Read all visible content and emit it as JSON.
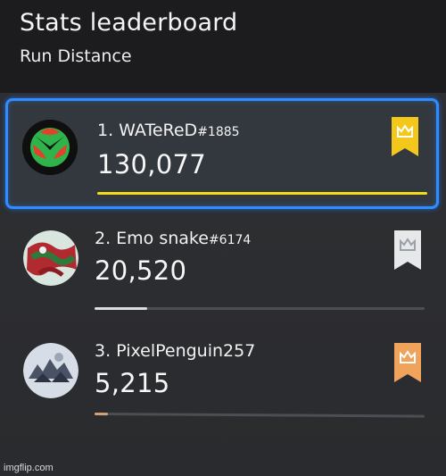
{
  "header": {
    "title": "Stats leaderboard",
    "subtitle": "Run Distance"
  },
  "entries": [
    {
      "rank_name": "1. WATeReD",
      "tag": "#1885",
      "score": "130,077",
      "progress": 1.0,
      "bar_color": "#f4dd17",
      "ribbon_color": "#f3c81a",
      "ribbon_icon": "crown-icon",
      "avatar_icon": "xbox-logo-icon"
    },
    {
      "rank_name": "2. Emo snake",
      "tag": "#6174",
      "score": "20,520",
      "progress": 0.16,
      "bar_color": "#d8dde2",
      "ribbon_color": "#e6e8ea",
      "ribbon_icon": "crown-icon",
      "avatar_icon": "gamerpic-icon"
    },
    {
      "rank_name": "3. PixelPenguin257",
      "tag": "",
      "score": "5,215",
      "progress": 0.04,
      "bar_color": "#d2a27c",
      "ribbon_color": "#f0a35a",
      "ribbon_icon": "crown-icon",
      "avatar_icon": "gamerpic-icon"
    }
  ],
  "colors": {
    "focus_border": "#2f8dff",
    "background": "#1c1c1e",
    "panel": "#2e2f32"
  },
  "watermark": "imgflip.com"
}
